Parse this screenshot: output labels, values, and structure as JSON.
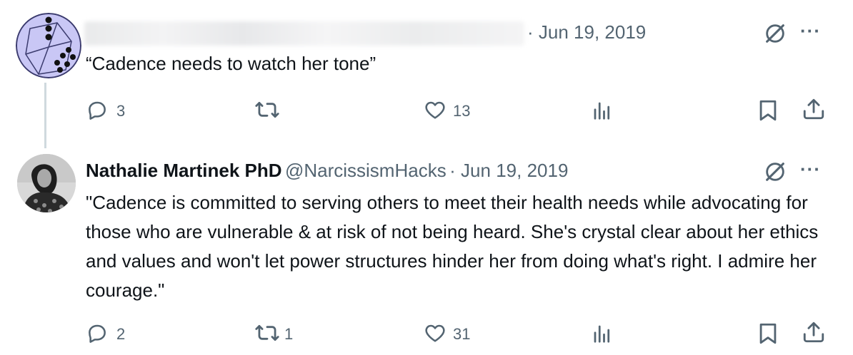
{
  "tweet1": {
    "date": "· Jun 19, 2019",
    "text": "“Cadence needs to watch her tone”",
    "actions": {
      "replies": "3",
      "reposts": "",
      "likes": "13"
    }
  },
  "tweet2": {
    "author_name": "Nathalie Martinek PhD",
    "handle": "@NarcissismHacks",
    "date": "· Jun 19, 2019",
    "text": "\"Cadence is committed to serving others to meet their health needs while advocating for those who are vulnerable & at risk of not being heard. She's crystal clear about her ethics and values and won't let power structures hinder her from doing what's right. I admire her courage.\"",
    "actions": {
      "replies": "2",
      "reposts": "1",
      "likes": "31"
    }
  },
  "icons": {
    "reply": "reply-icon",
    "repost": "repost-icon",
    "like": "like-icon",
    "views": "views-icon",
    "bookmark": "bookmark-icon",
    "share": "share-icon",
    "grok": "grok-icon",
    "more": "more-icon"
  },
  "colors": {
    "text": "#0f1419",
    "secondary": "#536471",
    "dice_fill": "#c9c7f5",
    "thread_line": "#cfd9de"
  }
}
